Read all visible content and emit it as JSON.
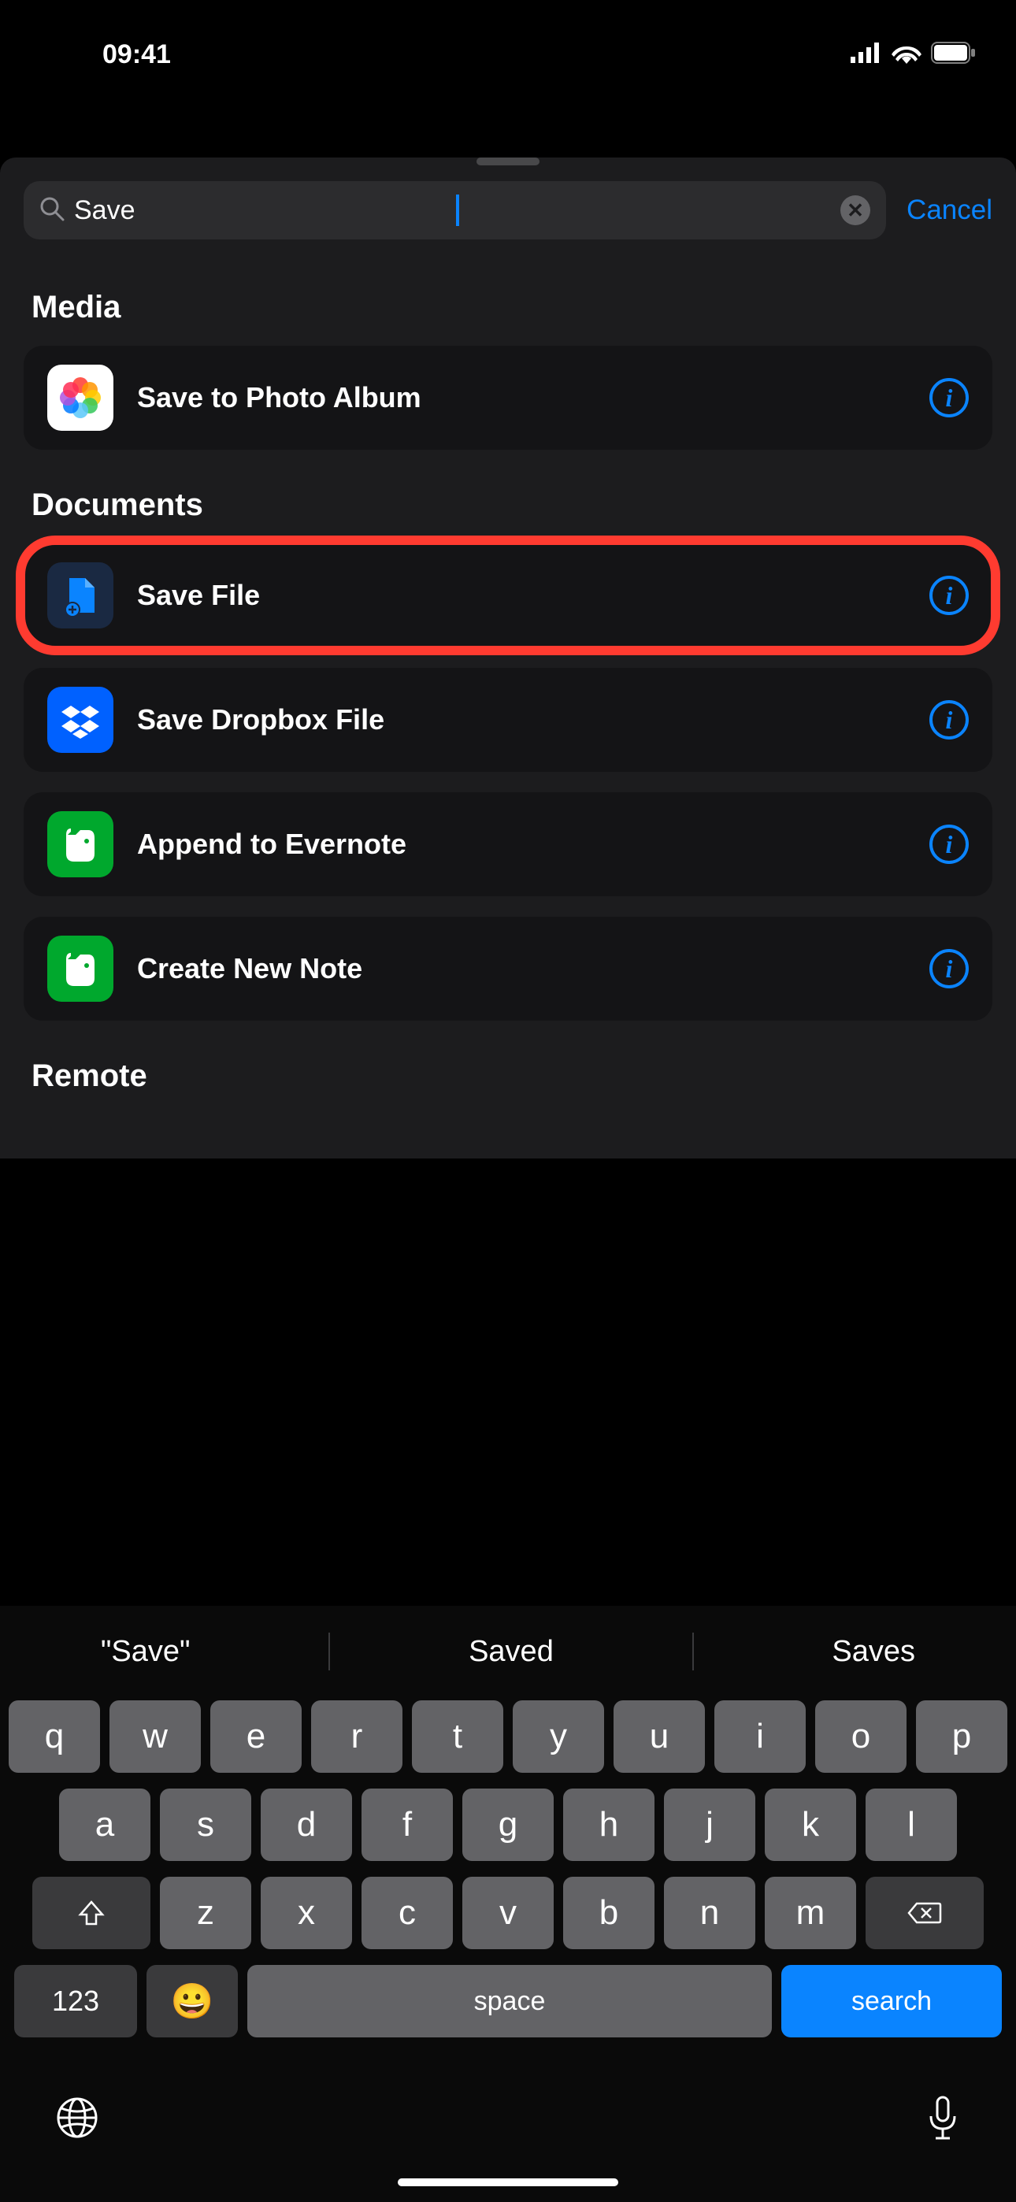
{
  "status": {
    "time": "09:41"
  },
  "search": {
    "value": "Save",
    "cancel": "Cancel"
  },
  "sections": [
    {
      "title": "Media",
      "items": [
        {
          "label": "Save to Photo Album",
          "icon": "photos",
          "highlighted": false
        }
      ]
    },
    {
      "title": "Documents",
      "items": [
        {
          "label": "Save File",
          "icon": "files",
          "highlighted": true
        },
        {
          "label": "Save Dropbox File",
          "icon": "dropbox",
          "highlighted": false
        },
        {
          "label": "Append to Evernote",
          "icon": "evernote",
          "highlighted": false
        },
        {
          "label": "Create New Note",
          "icon": "evernote",
          "highlighted": false
        }
      ]
    },
    {
      "title": "Remote",
      "items": []
    }
  ],
  "keyboard": {
    "suggestions": [
      "\"Save\"",
      "Saved",
      "Saves"
    ],
    "rows": [
      [
        "q",
        "w",
        "e",
        "r",
        "t",
        "y",
        "u",
        "i",
        "o",
        "p"
      ],
      [
        "a",
        "s",
        "d",
        "f",
        "g",
        "h",
        "j",
        "k",
        "l"
      ],
      [
        "z",
        "x",
        "c",
        "v",
        "b",
        "n",
        "m"
      ]
    ],
    "numKey": "123",
    "spaceKey": "space",
    "searchKey": "search"
  }
}
